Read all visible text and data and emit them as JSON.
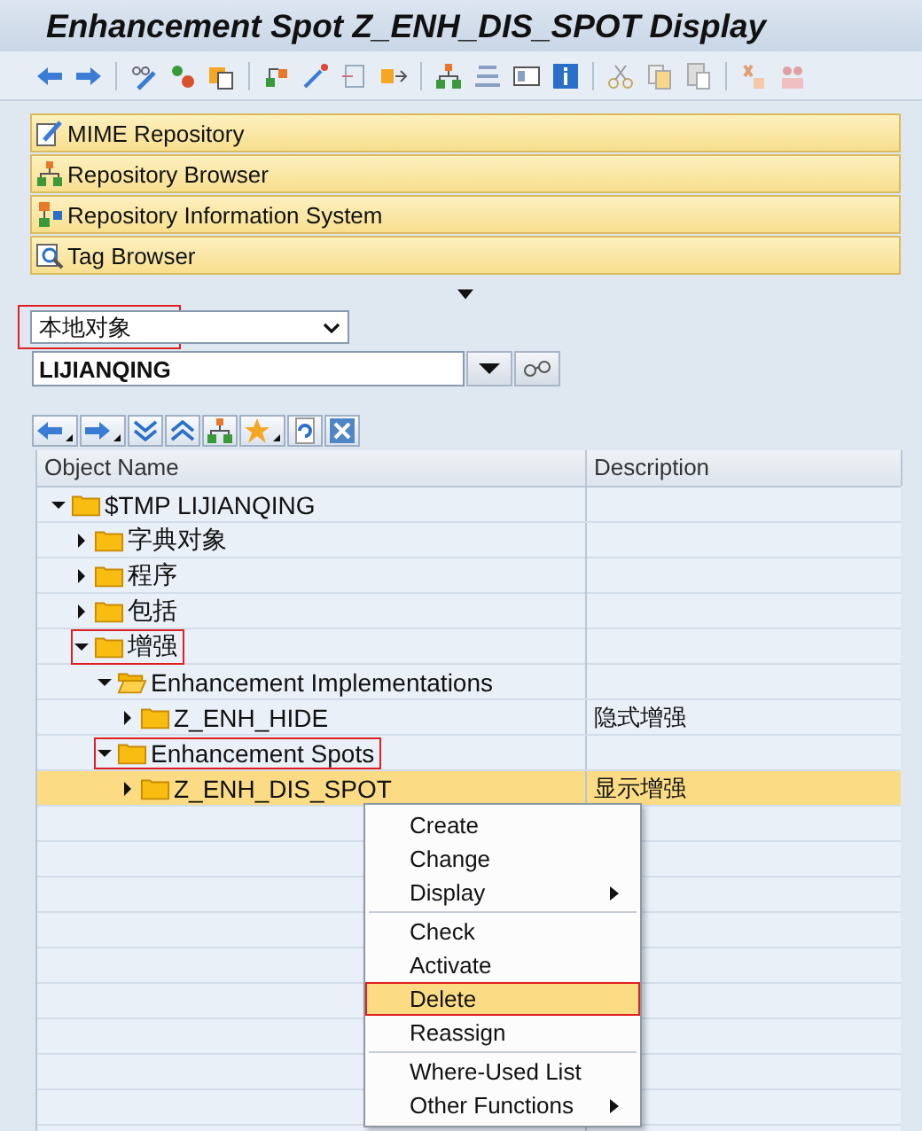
{
  "window": {
    "title": "Enhancement Spot Z_ENH_DIS_SPOT Display"
  },
  "navigation": [
    {
      "label": "MIME Repository"
    },
    {
      "label": "Repository Browser"
    },
    {
      "label": "Repository Information System"
    },
    {
      "label": "Tag Browser"
    }
  ],
  "object_list": {
    "value": "本地对象",
    "marked": true
  },
  "object_field": {
    "value": "LIJIANQING"
  },
  "tree": {
    "columns": [
      "Object Name",
      "Description"
    ],
    "nodes": [
      {
        "name": "$TMP LIJIANQING",
        "expanded": true,
        "selected": false,
        "marked": false,
        "folder_open": false,
        "children": [
          {
            "name": "字典对象",
            "expanded": false,
            "selected": false,
            "marked": false,
            "folder_open": false
          },
          {
            "name": "程序",
            "expanded": false,
            "selected": false,
            "marked": false,
            "folder_open": false
          },
          {
            "name": "包括",
            "expanded": false,
            "selected": false,
            "marked": false,
            "folder_open": false
          },
          {
            "name": "增强",
            "expanded": true,
            "selected": false,
            "marked": true,
            "folder_open": false,
            "children": [
              {
                "name": "Enhancement Implementations",
                "expanded": true,
                "selected": false,
                "marked": false,
                "folder_open": true,
                "children": [
                  {
                    "name": "Z_ENH_HIDE",
                    "description": "隐式增强",
                    "expanded": false,
                    "selected": false,
                    "marked": false,
                    "folder_open": false
                  }
                ]
              },
              {
                "name": "Enhancement Spots",
                "expanded": true,
                "selected": false,
                "marked": true,
                "folder_open": false,
                "children": [
                  {
                    "name": "Z_ENH_DIS_SPOT",
                    "description": "显示增强",
                    "expanded": false,
                    "selected": true,
                    "marked": false,
                    "folder_open": false
                  }
                ]
              }
            ]
          }
        ]
      }
    ]
  },
  "context_menu": {
    "groups": [
      [
        {
          "label": "Create",
          "submenu": false,
          "selected": false,
          "marked": false
        },
        {
          "label": "Change",
          "submenu": false,
          "selected": false,
          "marked": false
        },
        {
          "label": "Display",
          "submenu": true,
          "selected": false,
          "marked": false
        }
      ],
      [
        {
          "label": "Check",
          "submenu": false,
          "selected": false,
          "marked": false
        },
        {
          "label": "Activate",
          "submenu": false,
          "selected": false,
          "marked": false
        },
        {
          "label": "Delete",
          "submenu": false,
          "selected": true,
          "marked": true
        },
        {
          "label": "Reassign",
          "submenu": false,
          "selected": false,
          "marked": false
        }
      ],
      [
        {
          "label": "Where-Used List",
          "submenu": false,
          "selected": false,
          "marked": false
        },
        {
          "label": "Other Functions",
          "submenu": true,
          "selected": false,
          "marked": false
        }
      ]
    ]
  }
}
